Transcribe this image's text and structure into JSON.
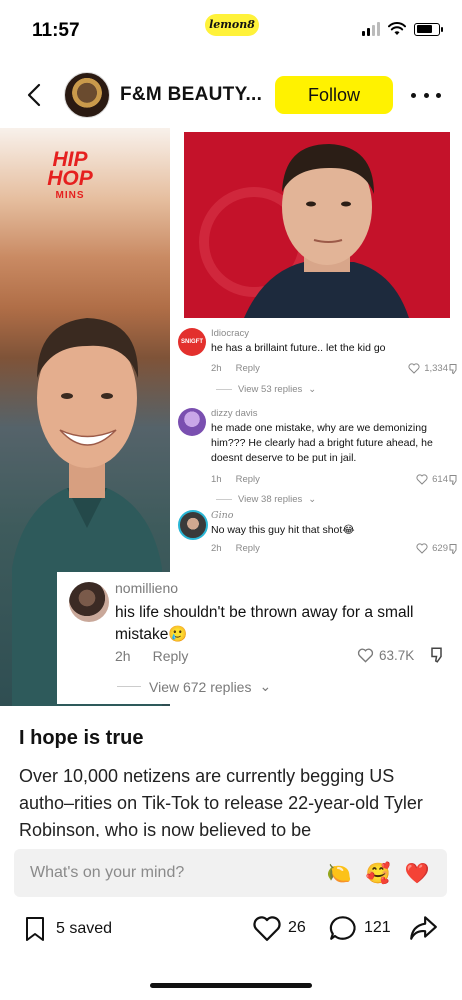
{
  "status_bar": {
    "time": "11:57",
    "app_logo_text": "lemon8"
  },
  "header": {
    "brand_name": "F&M BEAUTY...",
    "follow_label": "Follow"
  },
  "image": {
    "logo": {
      "line1": "HIP",
      "line2": "HOP",
      "line3": "MINS"
    },
    "comments": [
      {
        "user": "Idiocracy",
        "avatar_text": "SNIGFT",
        "text": "he has a brillaint future.. let the kid go",
        "time": "2h",
        "reply": "Reply",
        "likes": "1,334",
        "view_replies": "View 53 replies"
      },
      {
        "user": "dizzy davis",
        "text": "he made one mistake, why are we demonizing him??? He clearly had a bright future ahead, he doesnt deserve to be put in jail.",
        "time": "1h",
        "reply": "Reply",
        "likes": "614",
        "view_replies": "View 38 replies"
      },
      {
        "user": "Gino",
        "text": "No way this guy hit that shot😂",
        "time": "2h",
        "reply": "Reply",
        "likes": "629"
      }
    ],
    "featured_comment": {
      "user": "nomillieno",
      "text": "his life shouldn't be thrown away for a small mistake🥲",
      "time": "2h",
      "reply": "Reply",
      "likes": "63.7K",
      "view_replies": "View 672 replies"
    }
  },
  "post": {
    "title": "I hope is true",
    "body": "Over 10,000 netizens are currently begging US autho–rities on Tik-Tok to release 22-year-old Tyler Robinson, who is now believed to be"
  },
  "comment_input": {
    "placeholder": "What's on your mind?",
    "emojis": [
      "🍋",
      "🥰",
      "❤️"
    ]
  },
  "actions": {
    "saved": "5 saved",
    "likes": "26",
    "comments": "121"
  }
}
